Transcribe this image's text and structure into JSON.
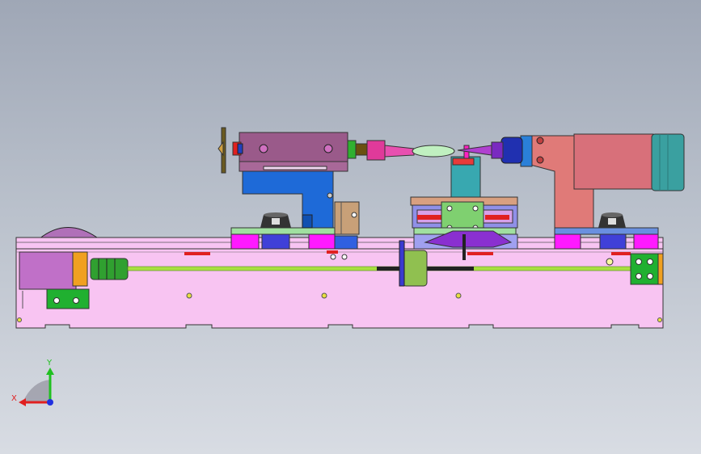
{
  "viewport": {
    "background_top": "#9fa7b6",
    "background_bottom": "#d8dce3"
  },
  "triad": {
    "x_label": "X",
    "y_label": "Y",
    "x_color": "#e02020",
    "y_color": "#20c020",
    "z_color": "#2030e0"
  },
  "palette": {
    "base_body": "#f8c4f2",
    "motor": "#c070c8",
    "magenta_pad": "#ff1aff",
    "blue_block": "#4040d8",
    "headstock": "#9a5a8a",
    "bracket_blue": "#1e6ad8",
    "tailstock_salmon": "#e07a78",
    "cylinder_teal": "#3aa0a0",
    "leadscrew": "#a8e040",
    "green_plate": "#20b030",
    "carriage_blue": "#a0a0f0"
  }
}
